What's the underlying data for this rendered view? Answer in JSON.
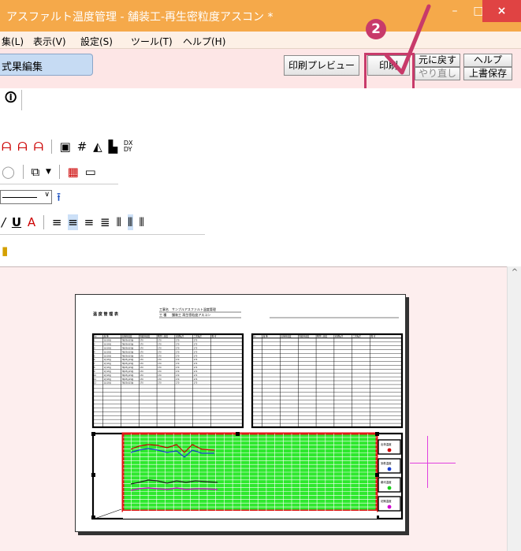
{
  "window": {
    "title": "アスファルト温度管理 - 舗装工-再生密粒度アスコン *",
    "min": "–",
    "max": "□",
    "close": "×"
  },
  "menu": {
    "edit": "集(L)",
    "view": "表示(V)",
    "settings": "設定(S)",
    "tools": "ツール(T)",
    "help": "ヘルプ(H)"
  },
  "toolbar": {
    "tab_label": "式果編集",
    "print_preview": "印刷プレビュー",
    "print": "印刷",
    "undo": "元に戻す",
    "redo": "やり直し",
    "help": "ヘルプ",
    "save_over": "上書保存",
    "step_badge": "2"
  },
  "ribbon": {
    "dy_label": "DX\nDY"
  },
  "document": {
    "header_title": "温 度 管 理 表",
    "work_label": "工事名",
    "work_value": "サンプルアスファルト温度管理",
    "type_label": "工 種",
    "type_value": "舗装工 再生密粒度アスコン",
    "col_headers": [
      "No",
      "品 種",
      "出荷時温度",
      "到着時温度",
      "敷均し温度",
      "初期転圧",
      "二次転圧",
      "備 考"
    ],
    "rows": [
      [
        "1",
        "1月18日",
        "7時25分15秒",
        "170",
        "170",
        "170",
        "170"
      ],
      [
        "2",
        "1月18日",
        "7時25分15秒",
        "170",
        "170",
        "170",
        "170"
      ],
      [
        "3",
        "1月18日",
        "7時25分15秒",
        "170",
        "170",
        "170",
        "170"
      ],
      [
        "4",
        "1月18日",
        "7時25分15秒",
        "170",
        "170",
        "170",
        "170"
      ],
      [
        "5",
        "1月18日",
        "7時25分15秒",
        "170",
        "170",
        "170",
        "170"
      ],
      [
        "6",
        "1月18日",
        "7時25分15秒",
        "170",
        "170",
        "170",
        "170"
      ],
      [
        "7",
        "1月18日",
        "7時25分15秒",
        "170",
        "170",
        "170",
        "170"
      ],
      [
        "8",
        "1月18日",
        "7時25分15秒",
        "170",
        "170",
        "170",
        "170"
      ],
      [
        "9",
        "1月18日",
        "7時25分15秒",
        "170",
        "170",
        "170",
        "170"
      ],
      [
        "10",
        "1月18日",
        "7時25分15秒",
        "170",
        "170",
        "170",
        "170"
      ],
      [
        "11",
        "1月18日",
        "7時25分15秒",
        "170",
        "170",
        "170",
        "170"
      ],
      [
        "12",
        "1月18日",
        "7時25分15秒",
        "170",
        "170",
        "170",
        "170"
      ]
    ],
    "legend": [
      "出荷温度",
      "到着温度",
      "敷均温度",
      "初期温度"
    ]
  },
  "colors": {
    "title_bar": "#f5a94a",
    "accent": "#c83a6a",
    "chart_fill": "#2ee82e",
    "chart_border": "#e01818"
  }
}
